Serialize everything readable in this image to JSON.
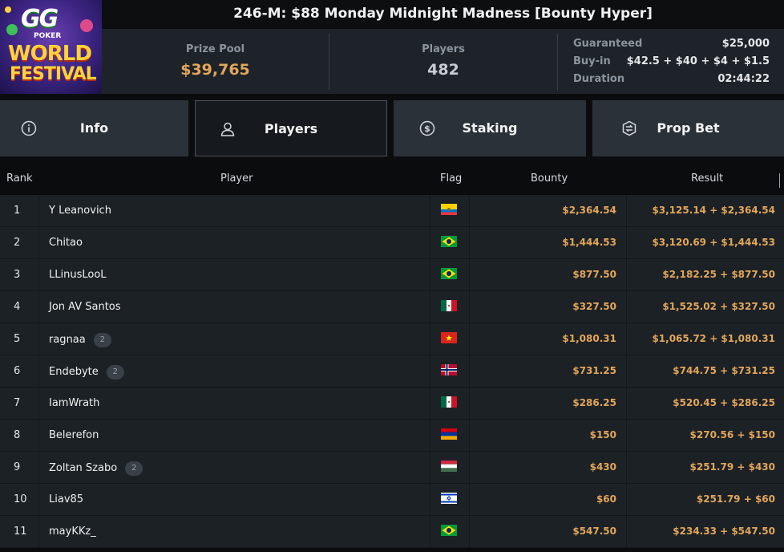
{
  "header": {
    "title": "246-M: $88 Monday Midnight Madness [Bounty Hyper]",
    "logo": {
      "line1": "GG",
      "line2": "POKER",
      "line3": "WORLD",
      "line4": "FESTIVAL"
    }
  },
  "stats": {
    "prize_pool_label": "Prize Pool",
    "prize_pool_value": "$39,765",
    "players_label": "Players",
    "players_value": "482",
    "details": [
      {
        "key": "Guaranteed",
        "value": "$25,000"
      },
      {
        "key": "Buy-in",
        "value": "$42.5 + $40 + $4 + $1.5"
      },
      {
        "key": "Duration",
        "value": "02:44:22"
      }
    ]
  },
  "tabs": [
    {
      "label": "Info",
      "icon": "info-icon"
    },
    {
      "label": "Players",
      "icon": "user-icon",
      "active": true
    },
    {
      "label": "Staking",
      "icon": "dollar-coin-icon"
    },
    {
      "label": "Prop Bet",
      "icon": "prop-bet-icon"
    }
  ],
  "table": {
    "columns": [
      "Rank",
      "Player",
      "Flag",
      "Bounty",
      "Result"
    ],
    "rows": [
      {
        "rank": "1",
        "player": "Y Leanovich",
        "badge": "",
        "flag": "ecuador",
        "bounty": "$2,364.54",
        "result": "$3,125.14 + $2,364.54"
      },
      {
        "rank": "2",
        "player": "Chitao",
        "badge": "",
        "flag": "brazil",
        "bounty": "$1,444.53",
        "result": "$3,120.69 + $1,444.53"
      },
      {
        "rank": "3",
        "player": "LLinusLooL",
        "badge": "",
        "flag": "brazil",
        "bounty": "$877.50",
        "result": "$2,182.25 + $877.50"
      },
      {
        "rank": "4",
        "player": "Jon AV Santos",
        "badge": "",
        "flag": "mexico",
        "bounty": "$327.50",
        "result": "$1,525.02 + $327.50"
      },
      {
        "rank": "5",
        "player": "ragnaa",
        "badge": "2",
        "flag": "vietnam",
        "bounty": "$1,080.31",
        "result": "$1,065.72 + $1,080.31"
      },
      {
        "rank": "6",
        "player": "Endebyte",
        "badge": "2",
        "flag": "norway",
        "bounty": "$731.25",
        "result": "$744.75 + $731.25"
      },
      {
        "rank": "7",
        "player": "IamWrath",
        "badge": "",
        "flag": "mexico",
        "bounty": "$286.25",
        "result": "$520.45 + $286.25"
      },
      {
        "rank": "8",
        "player": "Belerefon",
        "badge": "",
        "flag": "armenia",
        "bounty": "$150",
        "result": "$270.56 + $150"
      },
      {
        "rank": "9",
        "player": "Zoltan Szabo",
        "badge": "2",
        "flag": "hungary",
        "bounty": "$430",
        "result": "$251.79 + $430"
      },
      {
        "rank": "10",
        "player": "Liav85",
        "badge": "",
        "flag": "israel",
        "bounty": "$60",
        "result": "$251.79 + $60"
      },
      {
        "rank": "11",
        "player": "mayKKz_",
        "badge": "",
        "flag": "brazil",
        "bounty": "$547.50",
        "result": "$234.33 + $547.50"
      }
    ]
  },
  "colors": {
    "accent": "#e2a65a",
    "panel": "#1e2329",
    "tab": "#2b3138",
    "row": "#1c2126"
  }
}
